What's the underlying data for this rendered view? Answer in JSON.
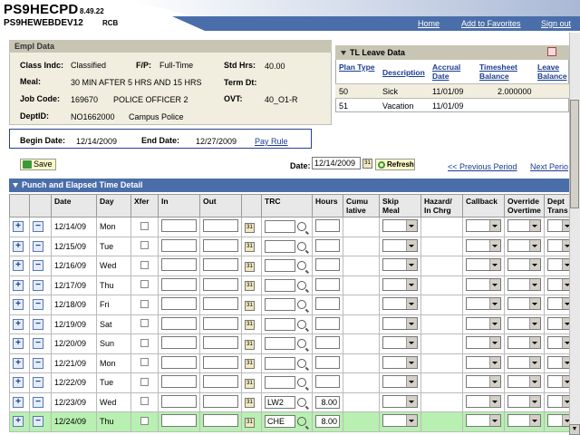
{
  "header": {
    "title": "PS9HECPD",
    "version": "8.49.22",
    "db": "PS9HEWEBDEV12",
    "user": "RCB",
    "links": [
      "Home",
      "Add to Favorites",
      "Sign out"
    ]
  },
  "empl": {
    "header": "Empl Data",
    "class_label": "Class Indc:",
    "class_value": "Classified",
    "fp_label": "F/P:",
    "fp_value": "Full-Time",
    "std_label": "Std Hrs:",
    "std_value": "40.00",
    "meal_label": "Meal:",
    "meal_value": "30 MIN AFTER 5 HRS AND 15 HRS",
    "term_label": "Term Dt:",
    "job_label": "Job Code:",
    "job_code": "169670",
    "job_title": "POLICE OFFICER 2",
    "ovt_label": "OVT:",
    "ovt_value": "40_O1-R",
    "dept_label": "DeptID:",
    "dept_id": "NO1662000",
    "dept_name": "Campus Police"
  },
  "leave": {
    "header": "TL Leave Data",
    "columns": [
      "Plan Type",
      "Description",
      "Accrual Date",
      "Timesheet Balance",
      "Leave Balance"
    ],
    "rows": [
      {
        "plan": "50",
        "desc": "Sick",
        "date": "11/01/09",
        "balance": "2.000000",
        "leave": ""
      },
      {
        "plan": "51",
        "desc": "Vacation",
        "date": "11/01/09",
        "balance": "",
        "leave": ""
      }
    ]
  },
  "period": {
    "begin_label": "Begin Date:",
    "begin": "12/14/2009",
    "end_label": "End Date:",
    "end": "12/27/2009",
    "payrule": "Pay Rule"
  },
  "toolbar": {
    "save": "Save",
    "date_label": "Date:",
    "date_value": "12/14/2009",
    "refresh": "Refresh",
    "prev": "<< Previous Period",
    "next": "Next Perio"
  },
  "punch": {
    "header": "Punch and Elapsed Time Detail",
    "columns": [
      "",
      "",
      "Date",
      "Day",
      "Xfer",
      "In",
      "Out",
      "",
      "TRC",
      "Hours",
      "Cumu lative",
      "Skip Meal",
      "Hazard/ In Chrg",
      "Callback",
      "Override Overtime",
      "Dept Trans"
    ],
    "rows": [
      {
        "date": "12/14/09",
        "day": "Mon",
        "trc": "",
        "hours": ""
      },
      {
        "date": "12/15/09",
        "day": "Tue",
        "trc": "",
        "hours": ""
      },
      {
        "date": "12/16/09",
        "day": "Wed",
        "trc": "",
        "hours": ""
      },
      {
        "date": "12/17/09",
        "day": "Thu",
        "trc": "",
        "hours": ""
      },
      {
        "date": "12/18/09",
        "day": "Fri",
        "trc": "",
        "hours": ""
      },
      {
        "date": "12/19/09",
        "day": "Sat",
        "trc": "",
        "hours": ""
      },
      {
        "date": "12/20/09",
        "day": "Sun",
        "trc": "",
        "hours": ""
      },
      {
        "date": "12/21/09",
        "day": "Mon",
        "trc": "",
        "hours": ""
      },
      {
        "date": "12/22/09",
        "day": "Tue",
        "trc": "",
        "hours": ""
      },
      {
        "date": "12/23/09",
        "day": "Wed",
        "trc": "LW2",
        "hours": "8.00"
      },
      {
        "date": "12/24/09",
        "day": "Thu",
        "trc": "CHE",
        "hours": "8.00"
      }
    ]
  }
}
